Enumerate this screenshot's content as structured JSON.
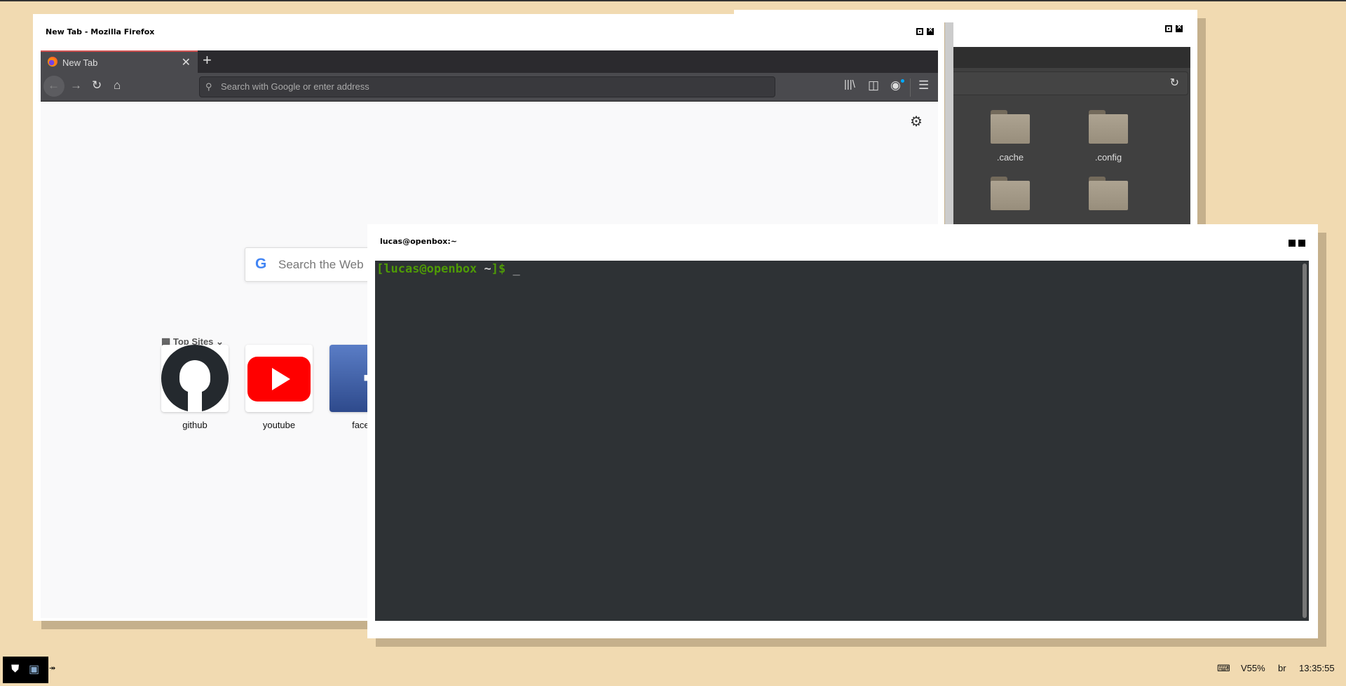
{
  "file_manager": {
    "folders": [
      ".cache",
      ".config",
      "",
      ""
    ]
  },
  "firefox": {
    "window_title": "New Tab - Mozilla Firefox",
    "tab_label": "New Tab",
    "new_tab_label": "+",
    "url_placeholder": "Search with Google or enter address",
    "search_placeholder": "Search the Web",
    "top_sites_label": "Top Sites",
    "top_sites": [
      {
        "label": "github"
      },
      {
        "label": "youtube"
      },
      {
        "label": "faceb"
      }
    ]
  },
  "terminal": {
    "window_title": "lucas@openbox:~",
    "prompt_user": "[lucas@openbox",
    "prompt_dir": " ~",
    "prompt_end": "]$",
    "cursor": " _",
    "colors": {
      "prompt": "#4e9a06",
      "background": "#2e3235"
    }
  },
  "taskbar": {
    "volume": "V55%",
    "layout": "br",
    "clock": "13:35:55"
  }
}
